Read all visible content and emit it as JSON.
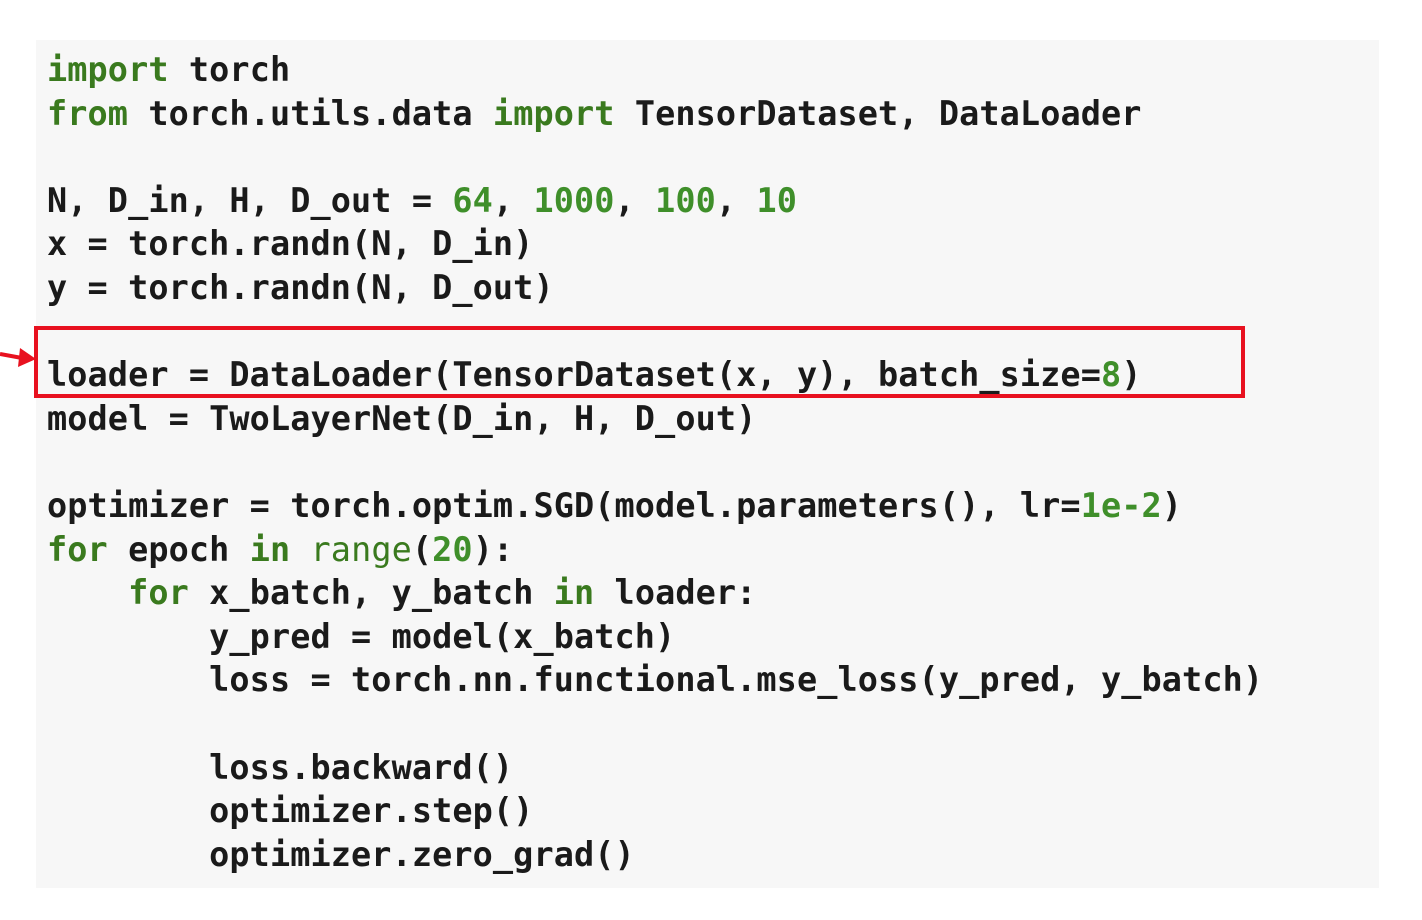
{
  "code": {
    "lines": [
      [
        {
          "t": "import",
          "k": "kw"
        },
        {
          "t": " torch",
          "k": "plain"
        }
      ],
      [
        {
          "t": "from",
          "k": "kw"
        },
        {
          "t": " torch.utils.data ",
          "k": "plain"
        },
        {
          "t": "import",
          "k": "kw"
        },
        {
          "t": " TensorDataset, DataLoader",
          "k": "plain"
        }
      ],
      [],
      [
        {
          "t": "N, D_in, H, D_out = ",
          "k": "plain"
        },
        {
          "t": "64",
          "k": "num"
        },
        {
          "t": ", ",
          "k": "plain"
        },
        {
          "t": "1000",
          "k": "num"
        },
        {
          "t": ", ",
          "k": "plain"
        },
        {
          "t": "100",
          "k": "num"
        },
        {
          "t": ", ",
          "k": "plain"
        },
        {
          "t": "10",
          "k": "num"
        }
      ],
      [
        {
          "t": "x = torch.randn(N, D_in)",
          "k": "plain"
        }
      ],
      [
        {
          "t": "y = torch.randn(N, D_out)",
          "k": "plain"
        }
      ],
      [],
      [
        {
          "t": "loader = DataLoader(TensorDataset(x, y), batch_size=",
          "k": "plain"
        },
        {
          "t": "8",
          "k": "num"
        },
        {
          "t": ")",
          "k": "plain"
        }
      ],
      [
        {
          "t": "model = TwoLayerNet(D_in, H, D_out)",
          "k": "plain"
        }
      ],
      [],
      [
        {
          "t": "optimizer = torch.optim.SGD(model.parameters(), lr=",
          "k": "plain"
        },
        {
          "t": "1e-2",
          "k": "num"
        },
        {
          "t": ")",
          "k": "plain"
        }
      ],
      [
        {
          "t": "for",
          "k": "kw"
        },
        {
          "t": " epoch ",
          "k": "plain"
        },
        {
          "t": "in",
          "k": "kw"
        },
        {
          "t": " ",
          "k": "plain"
        },
        {
          "t": "range",
          "k": "fn"
        },
        {
          "t": "(",
          "k": "plain"
        },
        {
          "t": "20",
          "k": "num"
        },
        {
          "t": "):",
          "k": "plain"
        }
      ],
      [
        {
          "t": "    ",
          "k": "plain"
        },
        {
          "t": "for",
          "k": "kw"
        },
        {
          "t": " x_batch, y_batch ",
          "k": "plain"
        },
        {
          "t": "in",
          "k": "kw"
        },
        {
          "t": " loader:",
          "k": "plain"
        }
      ],
      [
        {
          "t": "        y_pred = model(x_batch)",
          "k": "plain"
        }
      ],
      [
        {
          "t": "        loss = torch.nn.functional.mse_loss(y_pred, y_batch)",
          "k": "plain"
        }
      ],
      [],
      [
        {
          "t": "        loss.backward()",
          "k": "plain"
        }
      ],
      [
        {
          "t": "        optimizer.step()",
          "k": "plain"
        }
      ],
      [
        {
          "t": "        optimizer.zero_grad()",
          "k": "plain"
        }
      ]
    ],
    "highlighted_line": 7
  },
  "colors": {
    "keyword": "#3a7a1e",
    "number": "#3f8f2a",
    "text": "#1a1a1a",
    "background": "#f7f7f7",
    "highlight": "#e8111f"
  }
}
